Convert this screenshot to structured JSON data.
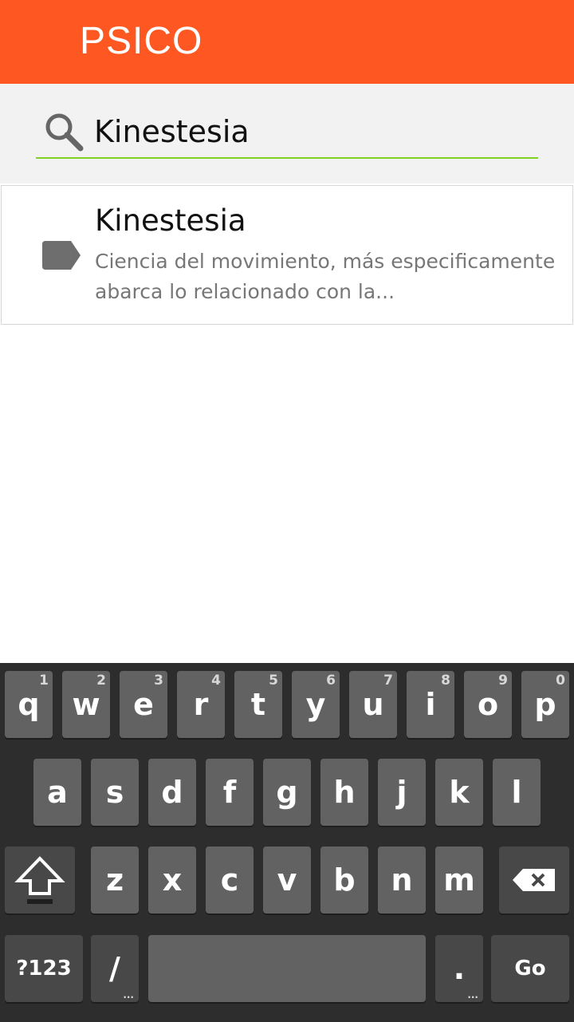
{
  "app": {
    "title": "PSICO"
  },
  "search": {
    "query": "Kinestesia"
  },
  "results": [
    {
      "title": "Kinestesia",
      "description": "Ciencia del movimiento, más especificamente abarca lo relacionado con la..."
    }
  ],
  "colors": {
    "appbar": "#ff5722",
    "search_underline": "#7ed321",
    "keyboard_bg": "#2d2d2d",
    "key": "#626262",
    "key_dark": "#484848"
  },
  "keyboard": {
    "row1": [
      {
        "label": "q",
        "hint": "1"
      },
      {
        "label": "w",
        "hint": "2"
      },
      {
        "label": "e",
        "hint": "3"
      },
      {
        "label": "r",
        "hint": "4"
      },
      {
        "label": "t",
        "hint": "5"
      },
      {
        "label": "y",
        "hint": "6"
      },
      {
        "label": "u",
        "hint": "7"
      },
      {
        "label": "i",
        "hint": "8"
      },
      {
        "label": "o",
        "hint": "9"
      },
      {
        "label": "p",
        "hint": "0"
      }
    ],
    "row2": [
      "a",
      "s",
      "d",
      "f",
      "g",
      "h",
      "j",
      "k",
      "l"
    ],
    "row3": [
      "z",
      "x",
      "c",
      "v",
      "b",
      "n",
      "m"
    ],
    "symbols_label": "?123",
    "slash_label": "/",
    "period_label": ".",
    "go_label": "Go",
    "more_hint": "..."
  }
}
